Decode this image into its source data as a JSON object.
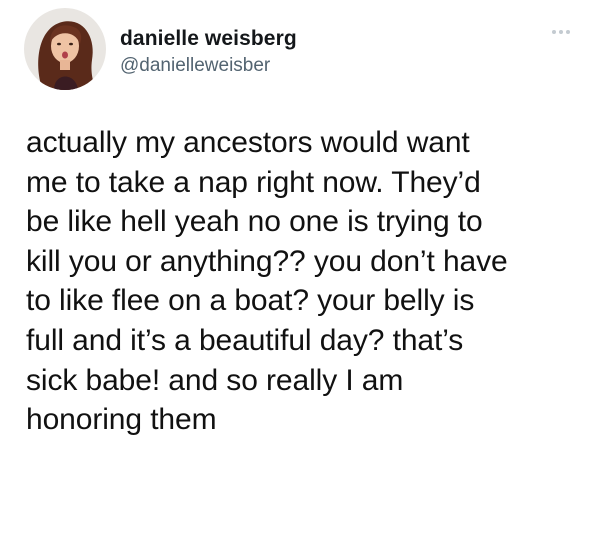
{
  "author": {
    "display_name": "danielle weisberg",
    "handle": "@danielleweisber",
    "avatar_icon": "profile-photo-avatar"
  },
  "more_icon": "more-options-icon",
  "tweet": {
    "lines": [
      "actually my ancestors would want",
      "me to take a nap right now. They’d",
      "be like hell yeah no one is trying to",
      "kill you or anything?? you don’t have",
      "to like flee on a boat? your belly is",
      "full and it’s a beautiful day? that’s",
      "sick babe!  and so really I am",
      "honoring them"
    ]
  },
  "colors": {
    "text": "#111111",
    "handle": "#536471",
    "background": "#ffffff"
  }
}
